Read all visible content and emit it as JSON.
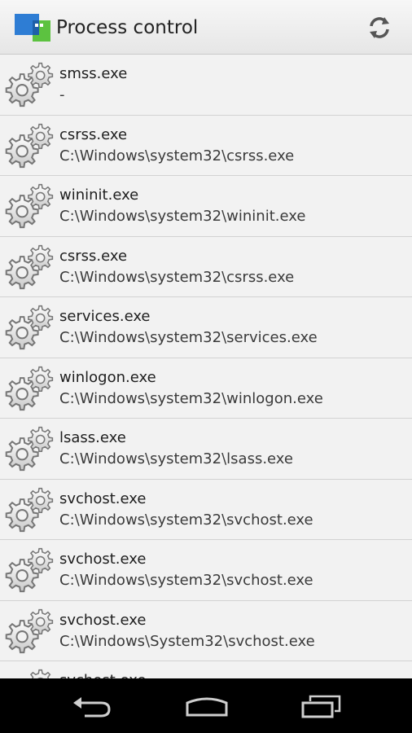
{
  "app": {
    "title": "Process control"
  },
  "colors": {
    "actionbar": "#eeeeee",
    "list_bg": "#f2f2f2",
    "navbar": "#000000",
    "icon_blue": "#2e7dd4",
    "icon_green": "#5cc240"
  },
  "icons": {
    "app": "app-logo-icon",
    "refresh": "refresh-icon",
    "process": "gears-icon",
    "back": "back-icon",
    "home": "home-icon",
    "recents": "recent-apps-icon"
  },
  "processes": [
    {
      "name": "smss.exe",
      "path": "-"
    },
    {
      "name": "csrss.exe",
      "path": "C:\\Windows\\system32\\csrss.exe"
    },
    {
      "name": "wininit.exe",
      "path": "C:\\Windows\\system32\\wininit.exe"
    },
    {
      "name": "csrss.exe",
      "path": "C:\\Windows\\system32\\csrss.exe"
    },
    {
      "name": "services.exe",
      "path": "C:\\Windows\\system32\\services.exe"
    },
    {
      "name": "winlogon.exe",
      "path": "C:\\Windows\\system32\\winlogon.exe"
    },
    {
      "name": "lsass.exe",
      "path": "C:\\Windows\\system32\\lsass.exe"
    },
    {
      "name": "svchost.exe",
      "path": "C:\\Windows\\system32\\svchost.exe"
    },
    {
      "name": "svchost.exe",
      "path": "C:\\Windows\\system32\\svchost.exe"
    },
    {
      "name": "svchost.exe",
      "path": "C:\\Windows\\System32\\svchost.exe"
    },
    {
      "name": "svchost.exe",
      "path": ""
    }
  ]
}
